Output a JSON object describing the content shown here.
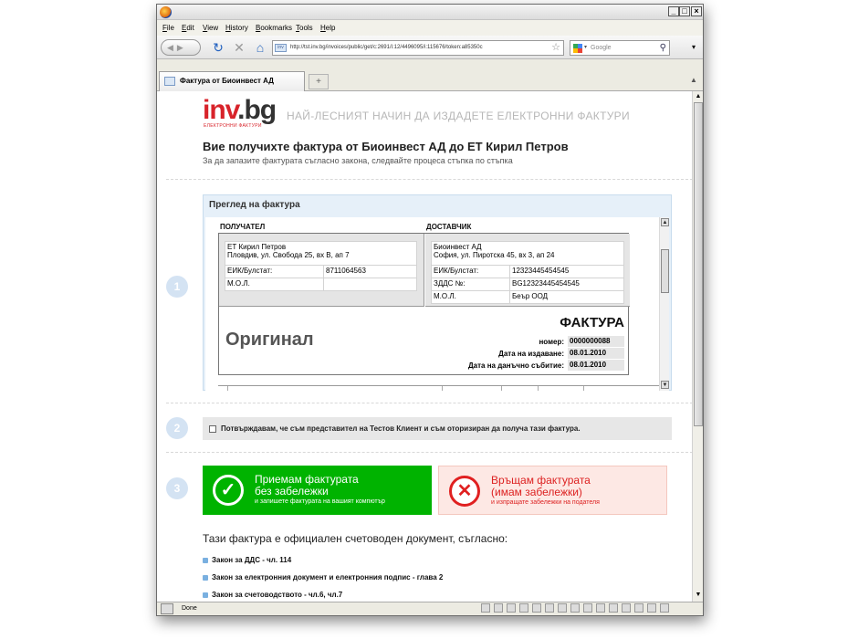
{
  "browser": {
    "menu": [
      "File",
      "Edit",
      "View",
      "History",
      "Bookmarks",
      "Tools",
      "Help"
    ],
    "url": "http://tst.inv.bg/invoices/public/get/c:2691/i:12/4496095/i:115676/token:a85350c",
    "search_placeholder": "Google",
    "tab_title": "Фактура от Биоинвест АД",
    "new_tab": "+",
    "status": "Done"
  },
  "page": {
    "logo": {
      "inv": "inv",
      "rest": ".bg",
      "subtitle": "ЕЛЕКТРОННИ ФАКТУРИ"
    },
    "tagline": "НАЙ-ЛЕСНИЯТ НАЧИН ДА ИЗДАДЕТЕ ЕЛЕКТРОННИ ФАКТУРИ",
    "heading": "Вие получихте фактура от Биоинвест АД до ЕТ Кирил Петров",
    "subheading": "За да запазите фактурата съгласно закона, следвайте процеса стъпка по стъпка",
    "steps": [
      "1",
      "2",
      "3"
    ],
    "preview_title": "Преглед на фактура",
    "recipient": {
      "header": "ПОЛУЧАТЕЛ",
      "name": "ЕТ Кирил Петров",
      "address": "Пловдив, ул. Свобода 25, вх В, ап 7",
      "eik_label": "ЕИК/Булстат:",
      "eik": "8711064563",
      "mol_label": "М.О.Л.",
      "mol": ""
    },
    "supplier": {
      "header": "ДОСТАВЧИК",
      "name": "Биоинвест АД",
      "address": "София, ул. Пиротска 45, вх 3, ап 24",
      "eik_label": "ЕИК/Булстат:",
      "eik": "12323445454545",
      "vat_label": "ЗДДС №:",
      "vat": "BG12323445454545",
      "mol_label": "М.О.Л.",
      "mol": "Беър ООД"
    },
    "original": "Оригинал",
    "invoice_title": "ФАКТУРА",
    "number_label": "номер:",
    "number": "0000000088",
    "issue_label": "Дата на издаване:",
    "issue_date": "08.01.2010",
    "tax_label": "Дата на данъчно събитие:",
    "tax_date": "08.01.2010",
    "confirm_text": "Потвърждавам, че съм представител на Тестов Клиент и съм оторизиран да получа тази фактура.",
    "accept": {
      "line1": "Приемам фактурата",
      "line2": "без забележки",
      "hint": "и запишете фактурата на вашият компютър"
    },
    "reject": {
      "line1": "Връщам фактурата",
      "line2": "(имам забележки)",
      "hint": "и изпращате забележки на подателя"
    },
    "legal_intro": "Тази фактура е официален счетоводен документ, съгласно:",
    "laws": [
      "Закон за ДДС - чл. 114",
      "Закон за електронния документ и електронния подпис - глава 2",
      "Закон за счетоводството - чл.6, чл.7"
    ]
  },
  "colors": {
    "accept": "#00b300",
    "brand_red": "#d8232a",
    "reject_text": "#dd2222"
  }
}
